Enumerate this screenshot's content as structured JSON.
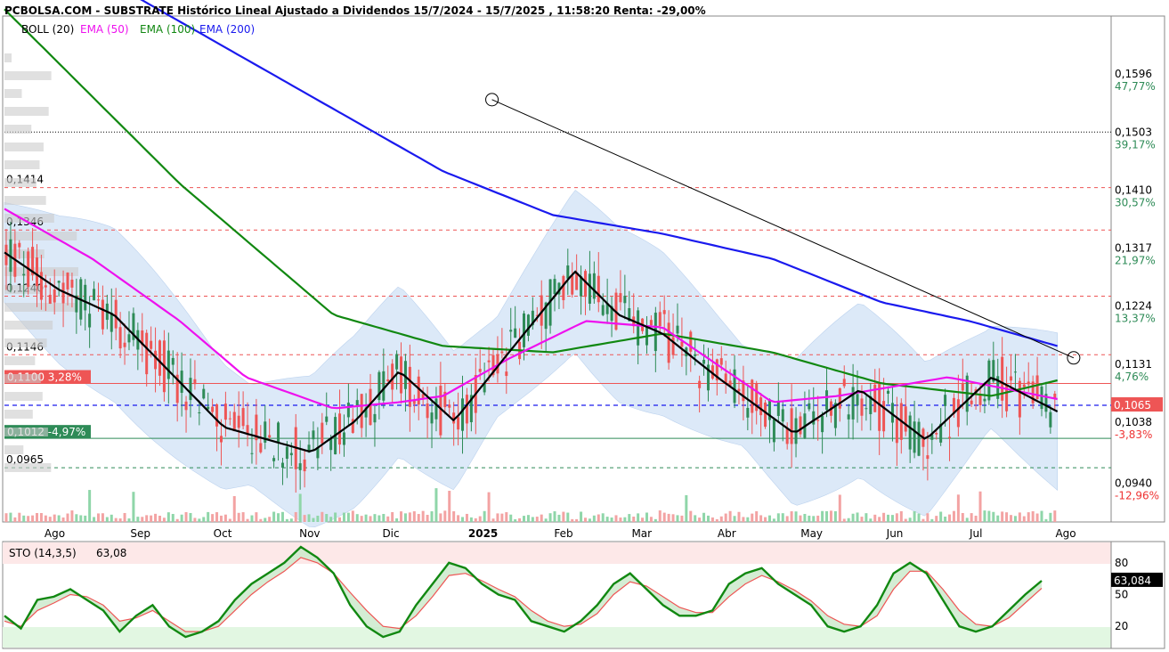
{
  "header": {
    "title": "PCBOLSA.COM - SUBSTRATE Histórico Lineal Ajustado a Dividendos 15/7/2024 - 15/7/2025 , 11:58:20 Renta: -29,00%"
  },
  "legend": [
    {
      "label": "BOLL (20)",
      "color": "#000000"
    },
    {
      "label": "EMA (50)",
      "color": "#ee11ee"
    },
    {
      "label": "EMA (100)",
      "color": "#118811"
    },
    {
      "label": "EMA (200)",
      "color": "#1a1aee"
    }
  ],
  "colors": {
    "up": "#2e8b57",
    "down": "#ee5555",
    "band": "#dce9f8",
    "ema50": "#ee11ee",
    "ema100": "#118811",
    "ema200": "#1a1aee",
    "boll": "#000000"
  },
  "chart_data": [
    {
      "type": "candlestick",
      "title": "SUBSTRATE",
      "ylim": [
        0.0878,
        0.1689
      ],
      "price_axis": [
        {
          "value": "0,1596",
          "pct": "47,77%"
        },
        {
          "value": "0,1503",
          "pct": "39,17%"
        },
        {
          "value": "0,1410",
          "pct": "30,57%"
        },
        {
          "value": "0,1317",
          "pct": "21,97%"
        },
        {
          "value": "0,1224",
          "pct": "13,37%"
        },
        {
          "value": "0,1131",
          "pct": "4,76%"
        },
        {
          "value": "0,1038",
          "pct": "-3,83%"
        },
        {
          "value": "0,0940",
          "pct": "-12,96%"
        }
      ],
      "last_price": "0,1065",
      "x_ticks": [
        "Ago",
        "Sep",
        "Oct",
        "Nov",
        "Dic",
        "2025",
        "Feb",
        "Mar",
        "Abr",
        "May",
        "Jun",
        "Jul",
        "Ago"
      ],
      "levels": [
        {
          "label": "0,1414",
          "value": 0.1414
        },
        {
          "label": "0,1346",
          "value": 0.1346
        },
        {
          "label": "0,1240",
          "value": 0.124
        },
        {
          "label": "0,1146",
          "value": 0.1146
        },
        {
          "label": "0,0965",
          "value": 0.0965
        }
      ],
      "resistance": {
        "value": 0.1503
      },
      "markers": [
        {
          "label": "0,1100",
          "pct": "3,28%",
          "value": 0.11,
          "color": "#ee5555"
        },
        {
          "label": "0,1012",
          "pct": "-4,97%",
          "value": 0.1012,
          "color": "#2e8b57"
        }
      ],
      "trendline": {
        "from": {
          "date": "2025-01-07",
          "value": 0.1555
        },
        "to": {
          "date": "2025-08-05",
          "value": 0.1141
        }
      },
      "ema200": [
        [
          0,
          0.186
        ],
        [
          0.1,
          0.174
        ],
        [
          0.2,
          0.164
        ],
        [
          0.3,
          0.154
        ],
        [
          0.4,
          0.144
        ],
        [
          0.5,
          0.137
        ],
        [
          0.6,
          0.134
        ],
        [
          0.7,
          0.13
        ],
        [
          0.8,
          0.123
        ],
        [
          0.88,
          0.12
        ],
        [
          0.96,
          0.116
        ]
      ],
      "ema100": [
        [
          0,
          0.17
        ],
        [
          0.08,
          0.156
        ],
        [
          0.16,
          0.142
        ],
        [
          0.3,
          0.121
        ],
        [
          0.4,
          0.116
        ],
        [
          0.5,
          0.115
        ],
        [
          0.6,
          0.118
        ],
        [
          0.7,
          0.115
        ],
        [
          0.8,
          0.11
        ],
        [
          0.9,
          0.108
        ],
        [
          0.96,
          0.1105
        ]
      ],
      "ema50": [
        [
          0,
          0.138
        ],
        [
          0.08,
          0.13
        ],
        [
          0.16,
          0.12
        ],
        [
          0.22,
          0.111
        ],
        [
          0.3,
          0.106
        ],
        [
          0.36,
          0.107
        ],
        [
          0.4,
          0.108
        ],
        [
          0.46,
          0.114
        ],
        [
          0.53,
          0.12
        ],
        [
          0.6,
          0.119
        ],
        [
          0.7,
          0.107
        ],
        [
          0.76,
          0.108
        ],
        [
          0.86,
          0.111
        ],
        [
          0.96,
          0.1075
        ]
      ],
      "boll_mid": [
        [
          0,
          0.131
        ],
        [
          0.05,
          0.125
        ],
        [
          0.1,
          0.121
        ],
        [
          0.2,
          0.103
        ],
        [
          0.28,
          0.099
        ],
        [
          0.32,
          0.104
        ],
        [
          0.36,
          0.112
        ],
        [
          0.41,
          0.104
        ],
        [
          0.46,
          0.115
        ],
        [
          0.52,
          0.128
        ],
        [
          0.56,
          0.121
        ],
        [
          0.6,
          0.118
        ],
        [
          0.65,
          0.111
        ],
        [
          0.72,
          0.102
        ],
        [
          0.78,
          0.109
        ],
        [
          0.84,
          0.101
        ],
        [
          0.9,
          0.111
        ],
        [
          0.96,
          0.1055
        ]
      ]
    },
    {
      "type": "line",
      "title": "STO (14,3,5)",
      "value_label": "63,08",
      "last_value": "63,084",
      "ylim": [
        0,
        100
      ],
      "y_ticks": [
        "80",
        "50",
        "20"
      ],
      "series": [
        {
          "values": [
            30,
            18,
            45,
            48,
            55,
            45,
            35,
            15,
            30,
            40,
            20,
            10,
            15,
            25,
            45,
            60,
            70,
            80,
            95,
            85,
            70,
            40,
            20,
            10,
            15,
            40,
            60,
            80,
            75,
            60,
            50,
            45,
            25,
            20,
            15,
            25,
            40,
            60,
            70,
            55,
            40,
            30,
            30,
            35,
            60,
            70,
            75,
            60,
            50,
            40,
            20,
            15,
            20,
            40,
            70,
            80,
            70,
            45,
            20,
            15,
            20,
            35,
            50,
            63
          ]
        },
        {
          "values": [
            25,
            20,
            35,
            42,
            50,
            48,
            40,
            25,
            28,
            35,
            25,
            15,
            15,
            20,
            35,
            50,
            62,
            72,
            85,
            80,
            70,
            52,
            35,
            20,
            18,
            30,
            48,
            68,
            70,
            63,
            55,
            48,
            35,
            25,
            20,
            22,
            32,
            50,
            62,
            58,
            48,
            38,
            33,
            33,
            48,
            60,
            68,
            62,
            54,
            44,
            30,
            22,
            20,
            30,
            55,
            72,
            72,
            55,
            35,
            22,
            20,
            28,
            42,
            56
          ]
        }
      ]
    }
  ]
}
